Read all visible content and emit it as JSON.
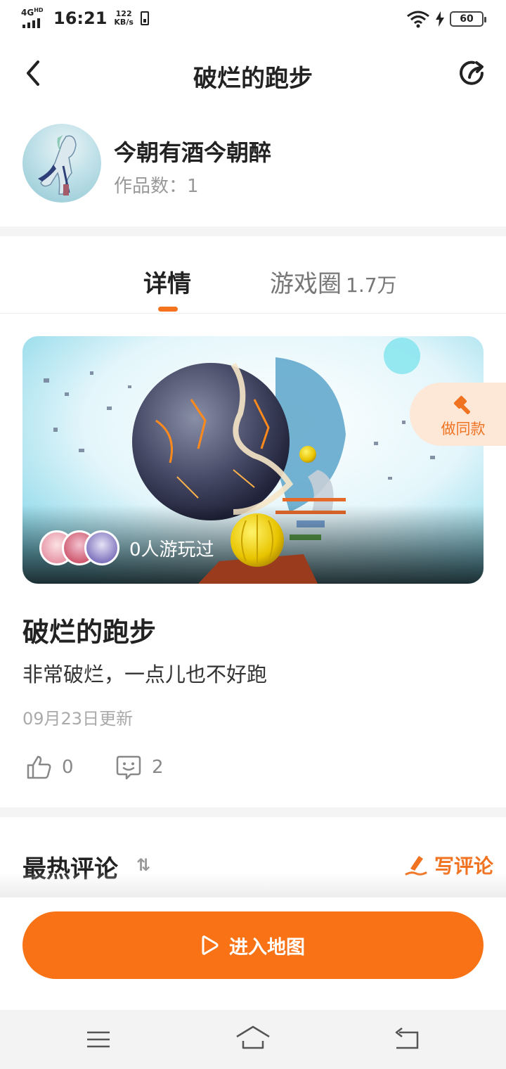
{
  "status_bar": {
    "network": "4G",
    "network_hd": "HD",
    "time": "16:21",
    "speed_value": "122",
    "speed_unit": "KB/s",
    "battery": "60"
  },
  "nav": {
    "title": "破烂的跑步"
  },
  "author": {
    "name": "今朝有酒今朝醉",
    "works": "作品数：1"
  },
  "tabs": {
    "detail": "详情",
    "circle": "游戏圈",
    "circle_count": "1.7万"
  },
  "banner": {
    "players_text": "0人游玩过"
  },
  "remix": {
    "label": "做同款"
  },
  "map": {
    "title": "破烂的跑步",
    "description": "非常破烂，一点儿也不好跑",
    "updated": "09月23日更新",
    "likes": "0",
    "comments": "2"
  },
  "comments_section": {
    "title": "最热评论",
    "sort_icon": "⇅",
    "write_label": "写评论"
  },
  "cta": {
    "label": "进入地图"
  },
  "colors": {
    "accent": "#f97316",
    "remix_bg": "#fde8d8"
  }
}
